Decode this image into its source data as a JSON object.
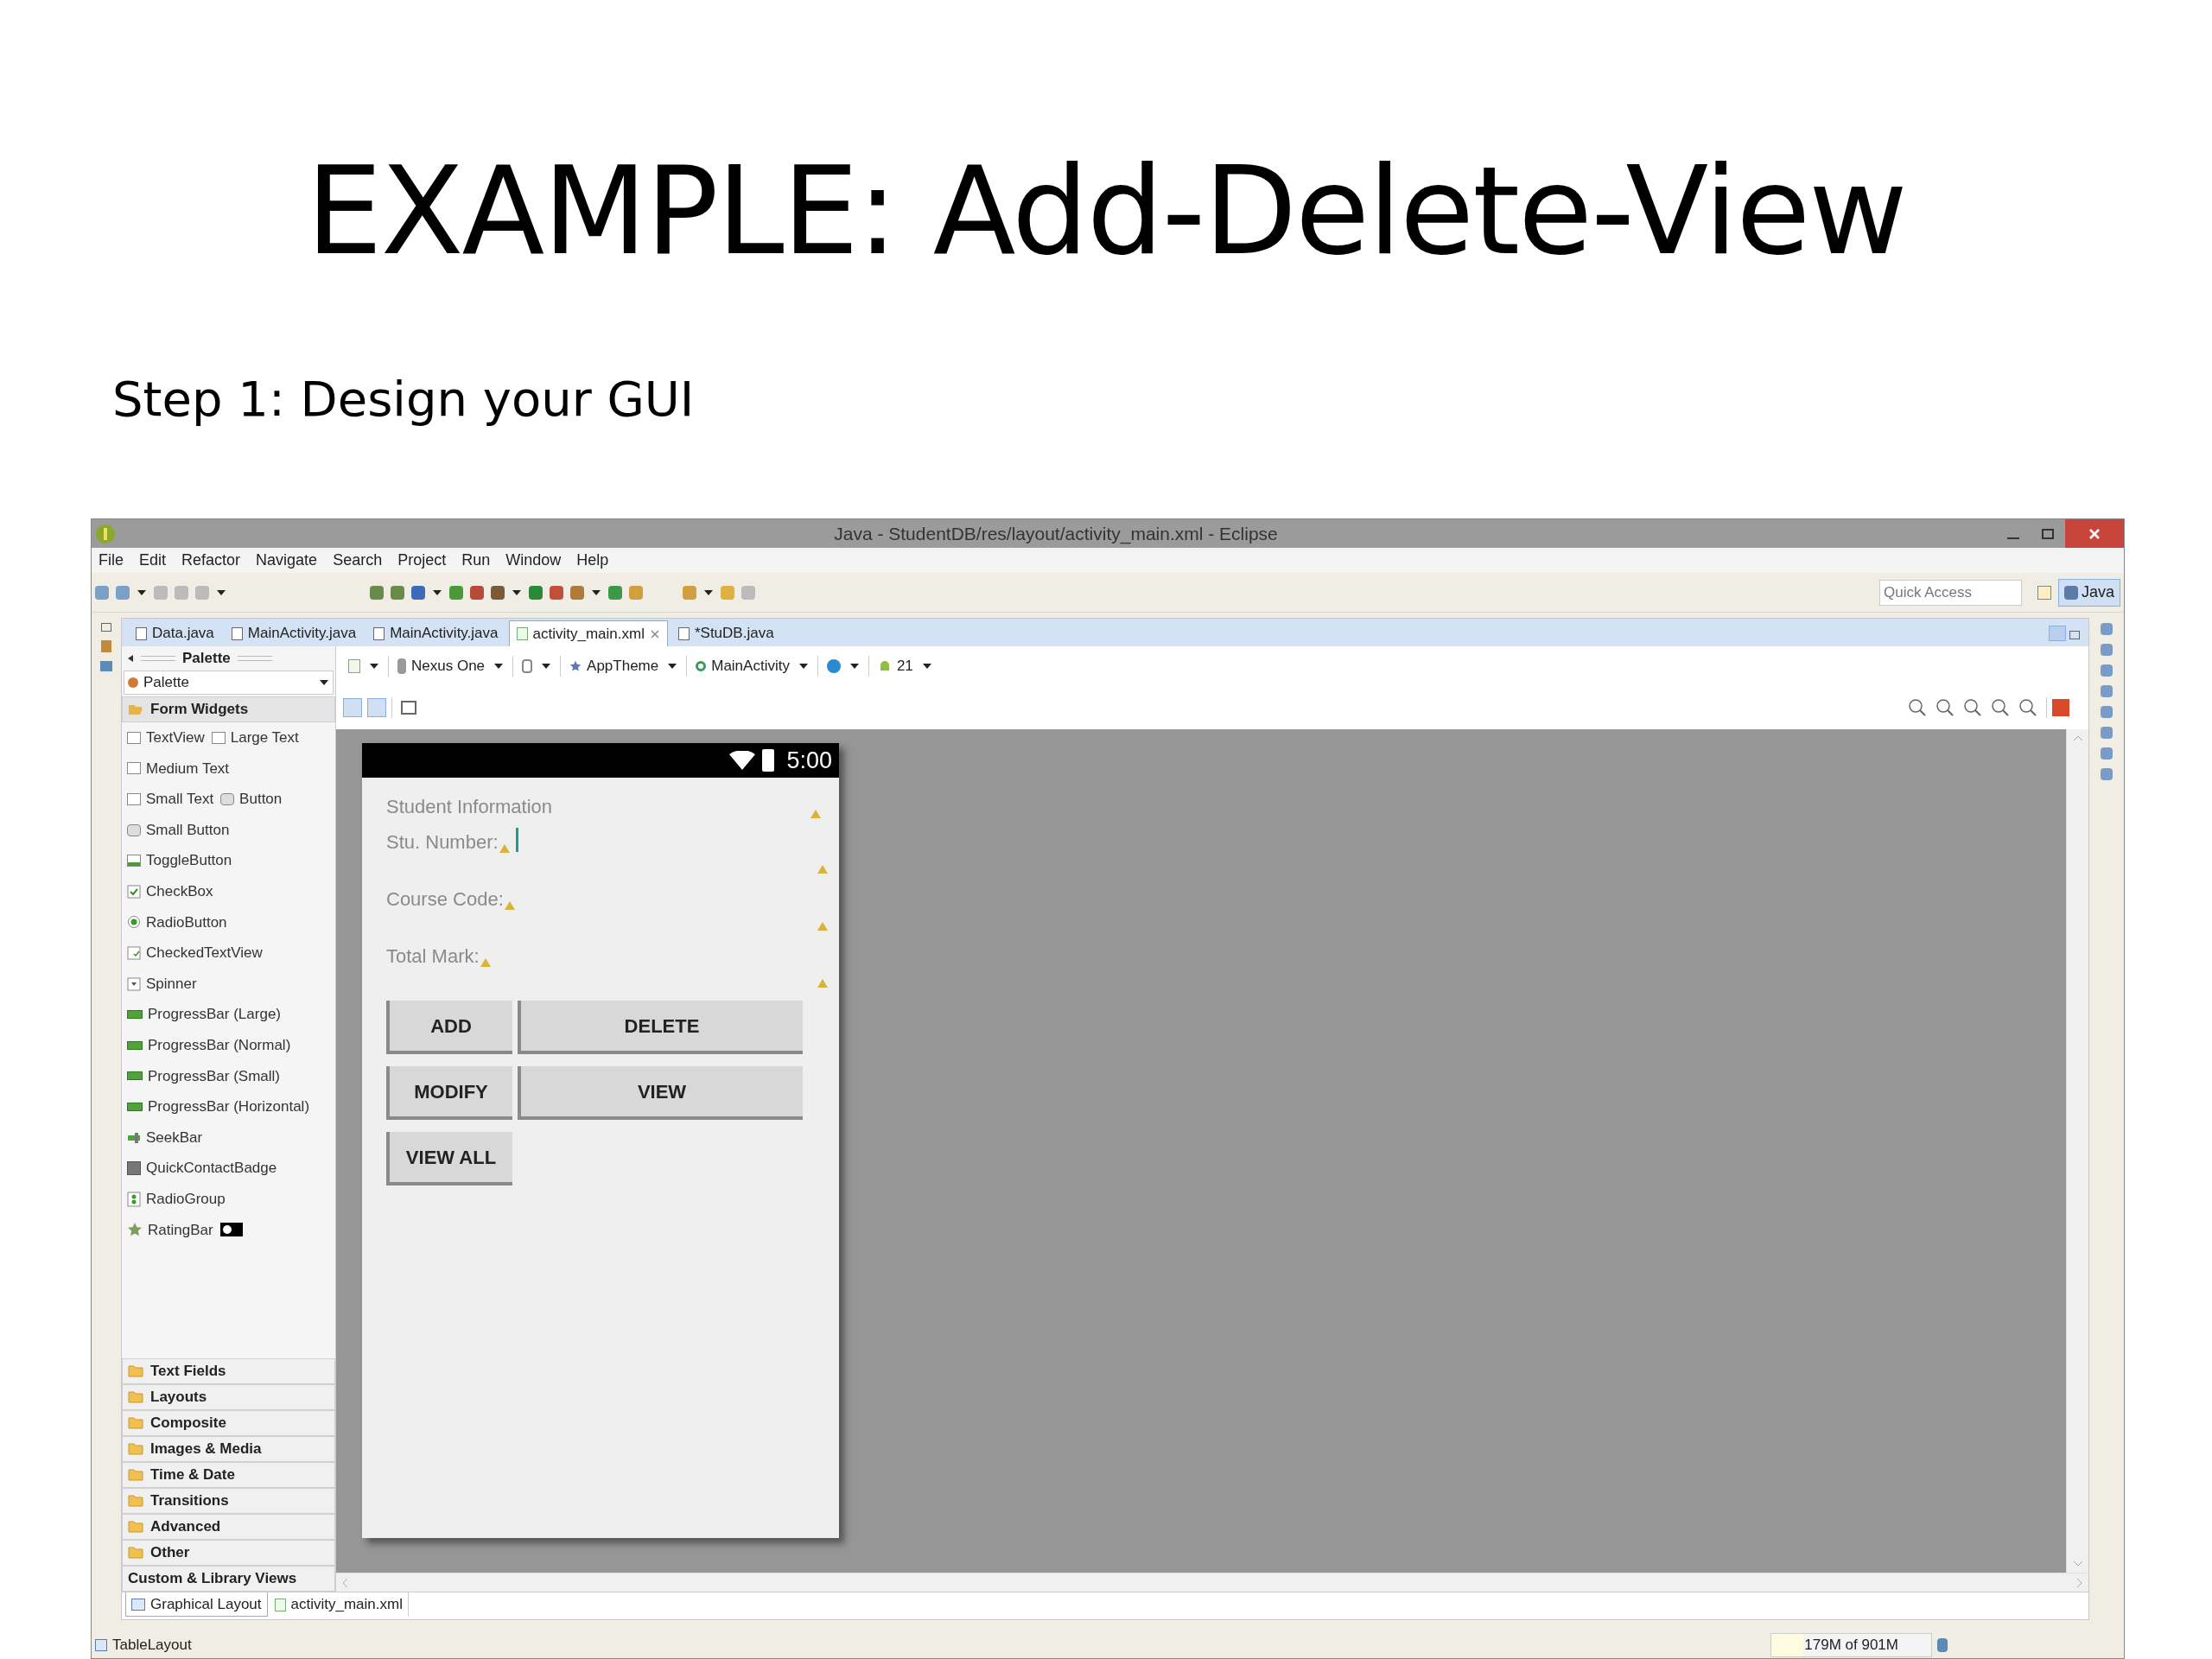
{
  "slide": {
    "title": "EXAMPLE: Add-Delete-View",
    "subtitle": "Step 1: Design your GUI"
  },
  "window": {
    "title": "Java - StudentDB/res/layout/activity_main.xml - Eclipse"
  },
  "menu": [
    "File",
    "Edit",
    "Refactor",
    "Navigate",
    "Search",
    "Project",
    "Run",
    "Window",
    "Help"
  ],
  "toolbar": {
    "quick_access": {
      "placeholder": "Quick Access"
    },
    "perspective": {
      "label": "Java",
      "selected": true
    }
  },
  "editor_tabs": [
    {
      "label": "Data.java",
      "kind": "java",
      "selected": false
    },
    {
      "label": "MainActivity.java",
      "kind": "java",
      "selected": false
    },
    {
      "label": "MainActivity.java",
      "kind": "java",
      "selected": false
    },
    {
      "label": "activity_main.xml",
      "kind": "xml",
      "selected": true
    },
    {
      "label": "*StuDB.java",
      "kind": "java",
      "selected": false
    }
  ],
  "palette": {
    "title": "Palette",
    "dropdown": "Palette",
    "sections": [
      {
        "label": "Form Widgets",
        "expanded": true,
        "folder": true,
        "rows": [
          [
            {
              "label": "TextView",
              "kind": "text"
            },
            {
              "label": "Large Text",
              "kind": "text"
            }
          ],
          [
            {
              "label": "Medium Text",
              "kind": "text"
            }
          ],
          [
            {
              "label": "Small Text",
              "kind": "text"
            },
            {
              "label": "Button",
              "kind": "button"
            }
          ],
          [
            {
              "label": "Small Button",
              "kind": "button"
            }
          ],
          [
            {
              "label": "ToggleButton",
              "kind": "toggle"
            }
          ],
          [
            {
              "label": "CheckBox",
              "kind": "checkbox"
            }
          ],
          [
            {
              "label": "RadioButton",
              "kind": "radio"
            }
          ],
          [
            {
              "label": "CheckedTextView",
              "kind": "checkedtext"
            }
          ],
          [
            {
              "label": "Spinner",
              "kind": "spinner"
            }
          ],
          [
            {
              "label": "ProgressBar (Large)",
              "kind": "progress"
            }
          ],
          [
            {
              "label": "ProgressBar (Normal)",
              "kind": "progress"
            }
          ],
          [
            {
              "label": "ProgressBar (Small)",
              "kind": "progress"
            }
          ],
          [
            {
              "label": "ProgressBar (Horizontal)",
              "kind": "progress"
            }
          ],
          [
            {
              "label": "SeekBar",
              "kind": "seekbar"
            }
          ],
          [
            {
              "label": "QuickContactBadge",
              "kind": "badge"
            }
          ],
          [
            {
              "label": "RadioGroup",
              "kind": "radiogroup"
            }
          ],
          [
            {
              "label": "RatingBar",
              "kind": "rating"
            },
            {
              "kind": "switch"
            }
          ]
        ]
      },
      {
        "label": "Text Fields",
        "expanded": false,
        "folder": true
      },
      {
        "label": "Layouts",
        "expanded": false,
        "folder": true
      },
      {
        "label": "Composite",
        "expanded": false,
        "folder": true
      },
      {
        "label": "Images & Media",
        "expanded": false,
        "folder": true
      },
      {
        "label": "Time & Date",
        "expanded": false,
        "folder": true
      },
      {
        "label": "Transitions",
        "expanded": false,
        "folder": true
      },
      {
        "label": "Advanced",
        "expanded": false,
        "folder": true
      },
      {
        "label": "Other",
        "expanded": false,
        "folder": true
      },
      {
        "label": "Custom & Library Views",
        "expanded": false,
        "folder": false
      }
    ]
  },
  "layout_toolbar": {
    "device": "Nexus One",
    "theme": "AppTheme",
    "activity": "MainActivity",
    "api": "21"
  },
  "phone": {
    "time": "5:00",
    "heading": "Student Information",
    "fields": [
      {
        "label": "Stu. Number:",
        "focused": true
      },
      {
        "label": "Course Code:",
        "focused": false
      },
      {
        "label": "Total Mark:",
        "focused": false
      }
    ],
    "button_rows": [
      [
        "ADD",
        "DELETE"
      ],
      [
        "MODIFY",
        "VIEW"
      ],
      [
        "VIEW ALL"
      ]
    ]
  },
  "bottom_tabs": [
    {
      "label": "Graphical Layout",
      "kind": "layout",
      "selected": true
    },
    {
      "label": "activity_main.xml",
      "kind": "xml",
      "selected": false
    }
  ],
  "status_bar": {
    "selection": "TableLayout",
    "memory": "179M of 901M"
  }
}
